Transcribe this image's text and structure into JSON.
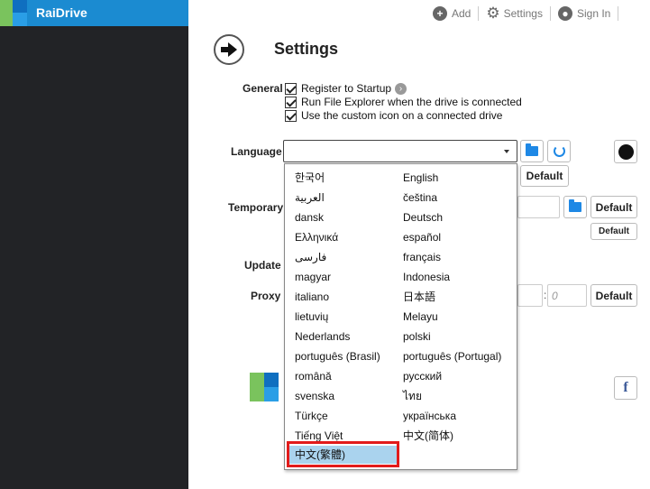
{
  "app": {
    "name": "RaiDrive"
  },
  "topbar": {
    "add_label": "Add",
    "settings_label": "Settings",
    "signin_label": "Sign In"
  },
  "header": {
    "title": "Settings"
  },
  "general": {
    "label": "General",
    "options": [
      {
        "label": "Register to Startup",
        "checked": true
      },
      {
        "label": "Run File Explorer when the drive is connected",
        "checked": true
      },
      {
        "label": "Use the custom icon on a connected drive",
        "checked": true
      }
    ]
  },
  "language": {
    "label": "Language",
    "selected_value": ""
  },
  "temporary": {
    "label": "Temporary"
  },
  "update": {
    "label": "Update"
  },
  "proxy": {
    "label": "Proxy",
    "port_placeholder": "0",
    "port_separator": ":"
  },
  "buttons": {
    "default_label": "Default"
  },
  "language_options_left": [
    "한국어",
    "العربية",
    "dansk",
    "Ελληνικά",
    "فارسی",
    "magyar",
    "italiano",
    "lietuvių",
    "Nederlands",
    "português (Brasil)",
    "română",
    "svenska",
    "Türkçe",
    "Tiếng Việt",
    "中文(繁體)"
  ],
  "language_options_right": [
    "English",
    "čeština",
    "Deutsch",
    "español",
    "français",
    "Indonesia",
    "日本語",
    "Melayu",
    "polski",
    "português (Portugal)",
    "русский",
    "ไทย",
    "українська",
    "中文(简体)"
  ],
  "highlighted_option": "中文(繁體)",
  "colors": {
    "accent": "#1b8bd1",
    "highlight_box": "#e21b1b",
    "selected_bg": "#aad3ee",
    "sidebar": "#222326"
  },
  "icons": [
    "plus-icon",
    "gear-icon",
    "user-icon",
    "back-arrow-icon",
    "folder-icon",
    "refresh-icon",
    "github-icon",
    "facebook-icon",
    "info-arrow-icon"
  ]
}
